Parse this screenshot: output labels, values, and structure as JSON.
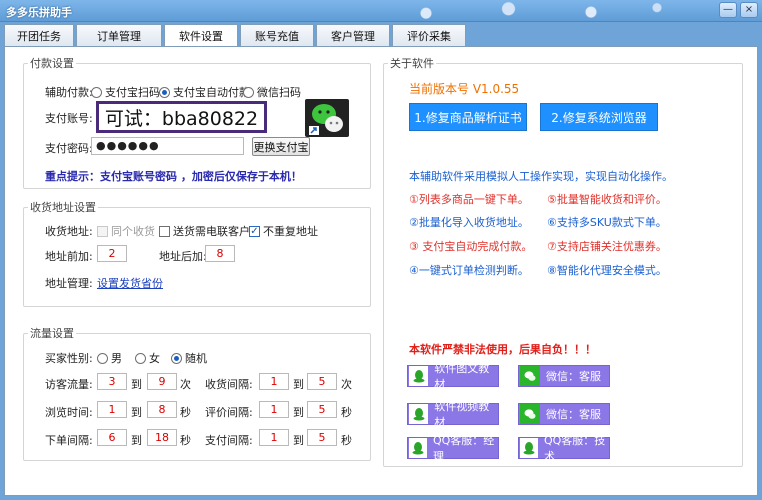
{
  "window": {
    "title": "多多乐拼助手",
    "min": "—",
    "close": "×"
  },
  "tabs": [
    "开团任务",
    "订单管理",
    "软件设置",
    "账号充值",
    "客户管理",
    "评价采集"
  ],
  "payment": {
    "legend": "付款设置",
    "aux_label": "辅助付款:",
    "options": [
      "支付宝扫码",
      "支付宝自动付款",
      "微信扫码"
    ],
    "account_label": "支付账号:",
    "account_value": "可试：bba80822",
    "password_label": "支付密码:",
    "password_value": "●●●●●●",
    "change_button": "更换支付宝",
    "tip": "重点提示：支付宝账号密码 ，加密后仅保存于本机！"
  },
  "address": {
    "legend": "收货地址设置",
    "addr_label": "收货地址:",
    "options": [
      "同个收货",
      "送货需电联客户",
      "不重复地址"
    ],
    "prefix_label": "地址前加:",
    "prefix_value": "2",
    "suffix_label": "地址后加:",
    "suffix_value": "8",
    "manage_label": "地址管理:",
    "manage_link": "设置发货省份"
  },
  "traffic": {
    "legend": "流量设置",
    "gender_label": "买家性别:",
    "gender_options": [
      "男",
      "女",
      "随机"
    ],
    "to": "到",
    "rows": [
      {
        "l_label": "访客流量:",
        "l_from": "3",
        "l_to": "9",
        "l_unit": "次",
        "r_label": "收货间隔:",
        "r_from": "1",
        "r_to": "5",
        "r_unit": "次"
      },
      {
        "l_label": "浏览时间:",
        "l_from": "1",
        "l_to": "8",
        "l_unit": "秒",
        "r_label": "评价间隔:",
        "r_from": "1",
        "r_to": "5",
        "r_unit": "秒"
      },
      {
        "l_label": "下单间隔:",
        "l_from": "6",
        "l_to": "18",
        "l_unit": "秒",
        "r_label": "支付间隔:",
        "r_from": "1",
        "r_to": "5",
        "r_unit": "秒"
      }
    ]
  },
  "about": {
    "legend": "关于软件",
    "version": "当前版本号 V1.0.55",
    "fix_cert": "1.修复商品解析证书",
    "fix_browser": "2.修复系统浏览器",
    "intro": "本辅助软件采用模拟人工操作实现，实现自动化操作。",
    "features_left": [
      "①列表多商品一键下单。",
      "②批量化导入收货地址。",
      "③ 支付宝自动完成付款。",
      "④一键式订单检测判断。"
    ],
    "features_right": [
      "⑤批量智能收货和评价。",
      "⑥支持多SKU款式下单。",
      "⑦支持店铺关注优惠券。",
      "⑧智能化代理安全模式。"
    ],
    "warning": "本软件严禁非法使用，后果自负！！！",
    "links": [
      "软件图文教材",
      "微信：客服",
      "软件视频教材",
      "微信：客服",
      "QQ客服：经理",
      "QQ客服：技术"
    ]
  },
  "colors": {
    "accent_blue": "#1e90ff",
    "purple": "#8b77e6",
    "feature_red": "#e0302a",
    "feature_blue": "#1a5fd0",
    "version_orange": "#f07000"
  }
}
